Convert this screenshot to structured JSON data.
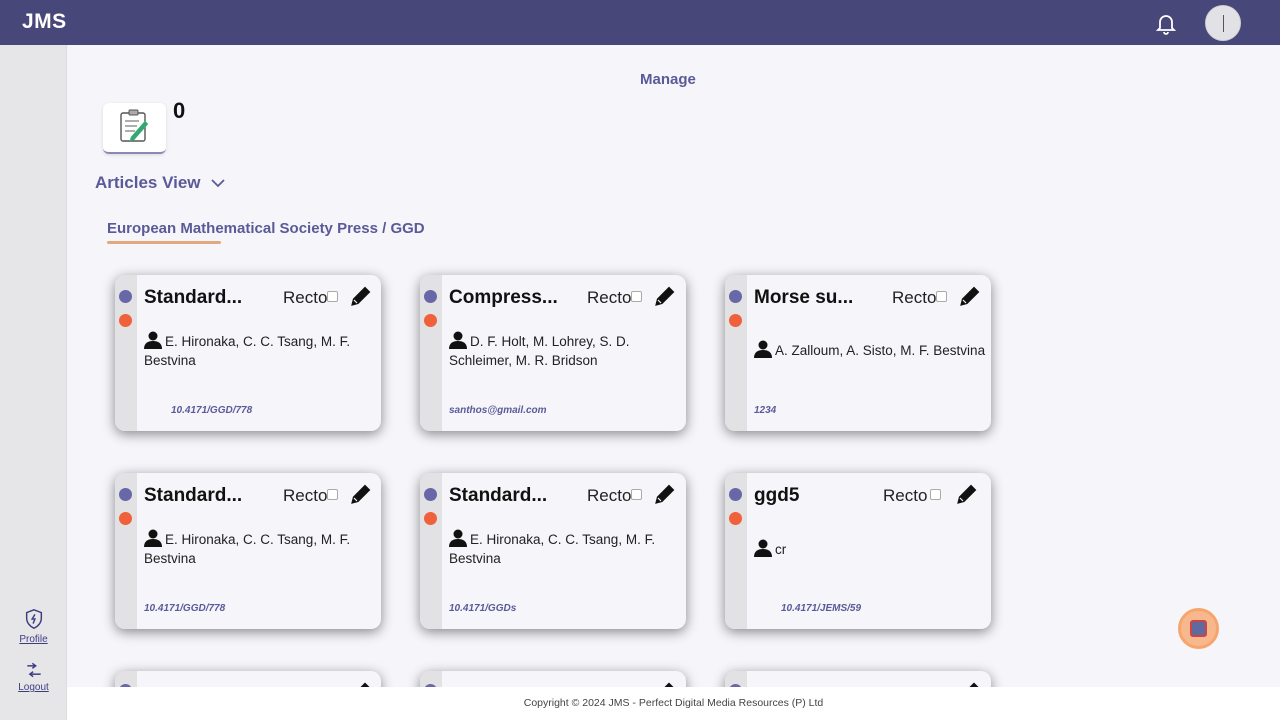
{
  "app": {
    "logo": "JMS"
  },
  "header": {
    "bell_icon": "bell-icon",
    "avatar_icon": "avatar"
  },
  "sidebar": {
    "profile_label": "Profile",
    "logout_label": "Logout"
  },
  "main": {
    "manage_label": "Manage",
    "stat_count": "0",
    "view_label": "Articles View",
    "journal_label": "European Mathematical Society Press / GGD"
  },
  "cards": [
    {
      "title": "Standard...",
      "recto": "Recto",
      "authors": "E. Hironaka, C. C. Tsang, M. F. Bestvina",
      "footer": "10.4171/GGD/778"
    },
    {
      "title": "Compress...",
      "recto": "Recto",
      "authors": "D. F. Holt, M. Lohrey, S. D. Schleimer, M. R. Bridson",
      "footer": "santhos@gmail.com"
    },
    {
      "title": "Morse su...",
      "recto": "Recto",
      "authors": "A. Zalloum, A. Sisto, M. F. Bestvina",
      "footer": "1234"
    },
    {
      "title": "Standard...",
      "recto": "Recto",
      "authors": "E. Hironaka, C. C. Tsang, M. F. Bestvina",
      "footer": "10.4171/GGD/778"
    },
    {
      "title": "Standard...",
      "recto": "Recto",
      "authors": "E. Hironaka, C. C. Tsang, M. F. Bestvina",
      "footer": "10.4171/GGDs"
    },
    {
      "title": "ggd5",
      "recto": "Recto",
      "authors": "cr",
      "footer": "10.4171/JEMS/59"
    }
  ],
  "footer": {
    "copyright": "Copyright © 2024 JMS - Perfect Digital Media Resources (P) Ltd"
  },
  "colors": {
    "header": "#48477a",
    "accent": "#5b5a98",
    "dot_blue": "#6867a8",
    "dot_orange": "#f0603a"
  }
}
